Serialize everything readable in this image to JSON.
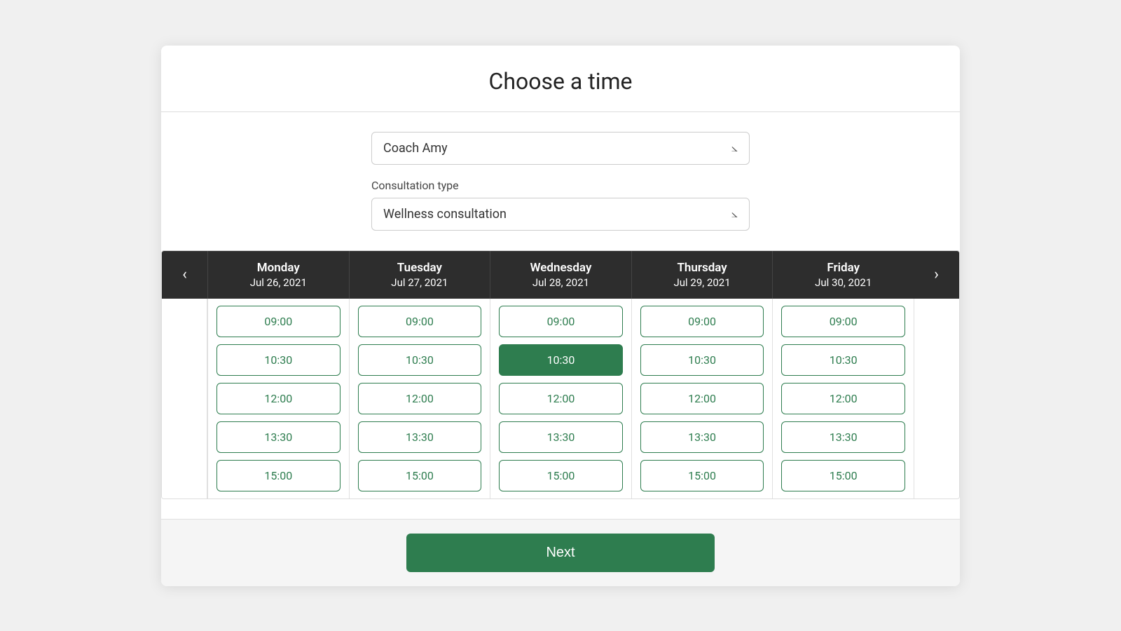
{
  "page": {
    "title": "Choose a time",
    "coach_label": "Coach Amy",
    "consultation_type_label": "Consultation type",
    "consultation_value": "Wellness consultation",
    "next_button": "Next"
  },
  "calendar": {
    "days": [
      {
        "name": "Monday",
        "date": "Jul 26, 2021"
      },
      {
        "name": "Tuesday",
        "date": "Jul 27, 2021"
      },
      {
        "name": "Wednesday",
        "date": "Jul 28, 2021"
      },
      {
        "name": "Thursday",
        "date": "Jul 29, 2021"
      },
      {
        "name": "Friday",
        "date": "Jul 30, 2021"
      }
    ],
    "time_slots": [
      "09:00",
      "10:30",
      "12:00",
      "13:30",
      "15:00"
    ],
    "selected": {
      "day": 2,
      "slot": 1
    }
  }
}
